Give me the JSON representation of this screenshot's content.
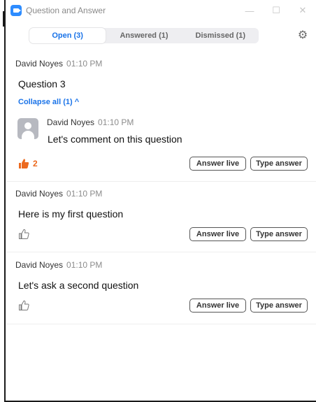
{
  "window": {
    "title": "Question and Answer",
    "controls": {
      "minimize": "—",
      "maximize": "☐",
      "close": "✕"
    }
  },
  "tabs": [
    {
      "label": "Open (3)",
      "active": true
    },
    {
      "label": "Answered (1)",
      "active": false
    },
    {
      "label": "Dismissed (1)",
      "active": false
    }
  ],
  "settings_icon": "gear-icon",
  "questions": [
    {
      "author": "David Noyes",
      "time": "01:10 PM",
      "text": "Question 3",
      "collapse_label": "Collapse all (1) ^",
      "reply": {
        "author": "David Noyes",
        "time": "01:10 PM",
        "text": "Let's comment on this question"
      },
      "likes": "2",
      "liked": true,
      "answer_live_label": "Answer live",
      "type_answer_label": "Type answer"
    },
    {
      "author": "David Noyes",
      "time": "01:10 PM",
      "text": "Here is my first question",
      "liked": false,
      "answer_live_label": "Answer live",
      "type_answer_label": "Type answer"
    },
    {
      "author": "David Noyes",
      "time": "01:10 PM",
      "text": "Let's ask a second question",
      "liked": false,
      "answer_live_label": "Answer live",
      "type_answer_label": "Type answer"
    }
  ],
  "colors": {
    "accent": "#1a73e8",
    "like": "#ec6a1f",
    "app_icon": "#2d8cff"
  }
}
